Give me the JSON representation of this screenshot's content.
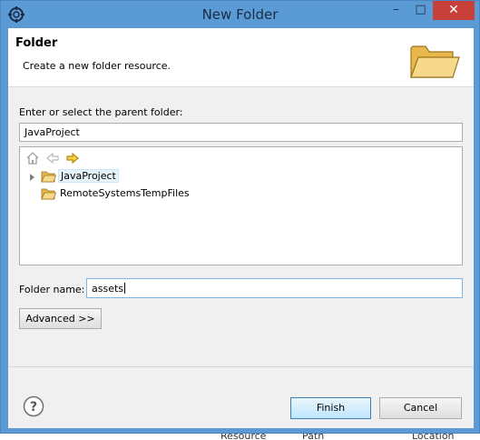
{
  "window": {
    "title": "New Folder",
    "minimize": "–",
    "maximize": "□",
    "close": "✕"
  },
  "header": {
    "title": "Folder",
    "description": "Create a new folder resource."
  },
  "parent": {
    "label": "Enter or select the parent folder:",
    "value": "JavaProject"
  },
  "tree": {
    "items": [
      {
        "label": "JavaProject",
        "selected": true,
        "expandable": true
      },
      {
        "label": "RemoteSystemsTempFiles",
        "selected": false,
        "expandable": false
      }
    ]
  },
  "folder_name": {
    "label": "Folder name:",
    "value": "assets"
  },
  "buttons": {
    "advanced": "Advanced >>",
    "finish": "Finish",
    "cancel": "Cancel"
  },
  "background": {
    "columns": [
      "Resource",
      "Path",
      "Location"
    ]
  },
  "icons": {
    "app": "eclipse-gear-icon",
    "header": "open-folder-icon",
    "home": "home-icon",
    "back": "back-arrow-icon",
    "forward": "forward-arrow-icon",
    "help": "help-icon"
  },
  "colors": {
    "titlebar": "#5b9bd5",
    "close": "#c7413a",
    "selection": "#e5f3fb"
  }
}
